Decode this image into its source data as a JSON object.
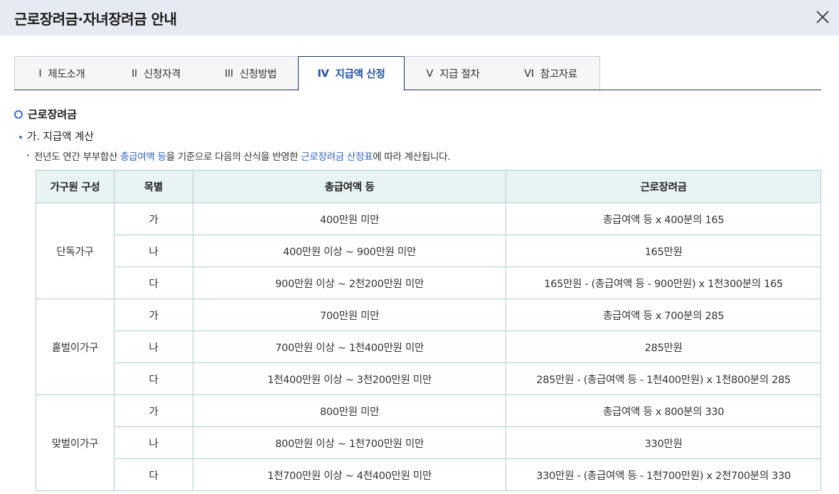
{
  "header": {
    "title": "근로장려금·자녀장려금 안내"
  },
  "tabs": [
    {
      "num": "I",
      "label": "제도소개",
      "active": false
    },
    {
      "num": "II",
      "label": "신청자격",
      "active": false
    },
    {
      "num": "III",
      "label": "신청방법",
      "active": false
    },
    {
      "num": "IV",
      "label": "지급액 산정",
      "active": true
    },
    {
      "num": "V",
      "label": "지급 절차",
      "active": false
    },
    {
      "num": "VI",
      "label": "참고자료",
      "active": false
    }
  ],
  "section": {
    "title": "근로장려금",
    "subtitle": "가. 지급액 계산",
    "note": {
      "part1": "전년도 연간 부부합산 ",
      "link1": "총급여액 등",
      "part2": "을 기준으로 다음의 산식을 반영한 ",
      "link2": "근로장려금 산정표",
      "part3": "에 따라 계산됩니다."
    }
  },
  "table": {
    "headers": [
      "가구원 구성",
      "목별",
      "총급여액 등",
      "근로장려금"
    ],
    "groups": [
      {
        "name": "단독가구",
        "rows": [
          {
            "item": "가",
            "income": "400만원 미만",
            "benefit": "총급여액 등 x 400분의 165"
          },
          {
            "item": "나",
            "income": "400만원 이상 ~ 900만원 미만",
            "benefit": "165만원"
          },
          {
            "item": "다",
            "income": "900만원 이상 ~ 2천200만원 미만",
            "benefit": "165만원 - (총급여액 등 - 900만원) x 1천300분의 165"
          }
        ]
      },
      {
        "name": "홑벌이가구",
        "rows": [
          {
            "item": "가",
            "income": "700만원 미만",
            "benefit": "총급여액 등 x 700분의 285"
          },
          {
            "item": "나",
            "income": "700만원 이상 ~ 1천400만원 미만",
            "benefit": "285만원"
          },
          {
            "item": "다",
            "income": "1천400만원 이상 ~ 3천200만원 미만",
            "benefit": "285만원 - (총급여액 등 - 1천400만원) x 1천800분의 285"
          }
        ]
      },
      {
        "name": "맞벌이가구",
        "rows": [
          {
            "item": "가",
            "income": "800만원 미만",
            "benefit": "총급여액 등 x 800분의 330"
          },
          {
            "item": "나",
            "income": "800만원 이상 ~ 1천700만원 미만",
            "benefit": "330만원"
          },
          {
            "item": "다",
            "income": "1천700만원 이상 ~ 4천400만원 미만",
            "benefit": "330만원 - (총급여액 등 - 1천700만원) x 2천700분의 330"
          }
        ]
      }
    ]
  },
  "icons": {
    "close": "close-icon"
  },
  "colors": {
    "accent": "#3d68d6",
    "link": "#2f63c4",
    "header_bg": "#e6ebf3",
    "table_head_bg": "#e8f3f3"
  }
}
